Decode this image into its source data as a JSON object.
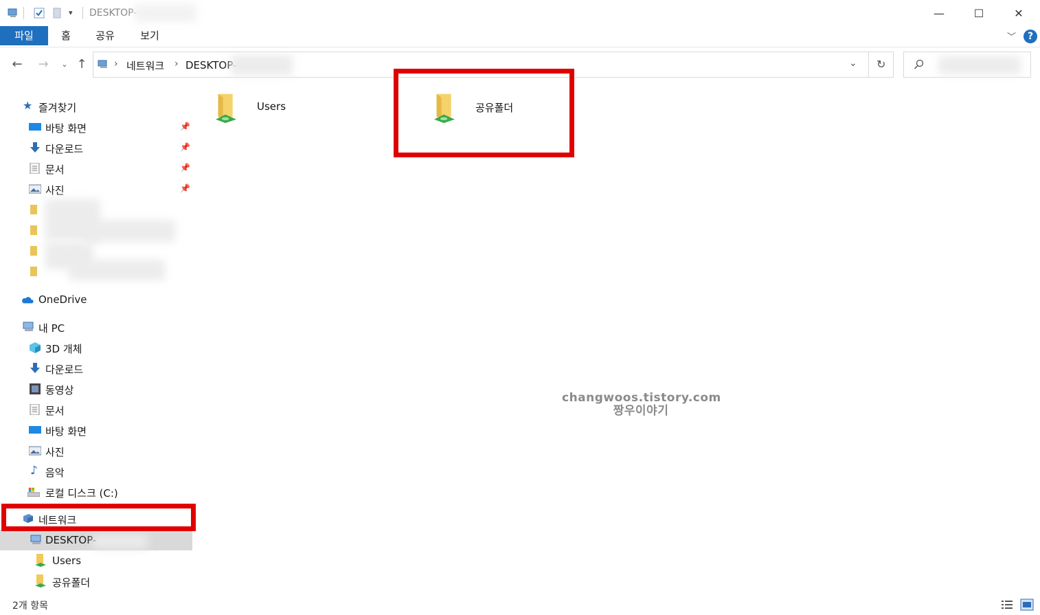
{
  "window": {
    "title": "DESKTOP-",
    "minimize": "—",
    "maximize": "☐",
    "close": "✕"
  },
  "ribbon": {
    "tabs": [
      "파일",
      "홈",
      "공유",
      "보기"
    ],
    "help": "?"
  },
  "address": {
    "crumbs": [
      "네트워크",
      "DESKTOP-"
    ]
  },
  "sidebar": {
    "quick_access": {
      "label": "즐겨찾기",
      "items": [
        {
          "label": "바탕 화면",
          "icon": "desktop-icon"
        },
        {
          "label": "다운로드",
          "icon": "download-icon"
        },
        {
          "label": "문서",
          "icon": "document-icon"
        },
        {
          "label": "사진",
          "icon": "pictures-icon"
        }
      ]
    },
    "onedrive": "OneDrive",
    "this_pc": {
      "label": "내 PC",
      "items": [
        {
          "label": "3D 개체",
          "icon": "3d-objects-icon"
        },
        {
          "label": "다운로드",
          "icon": "download-icon"
        },
        {
          "label": "동영상",
          "icon": "video-icon"
        },
        {
          "label": "문서",
          "icon": "document-icon"
        },
        {
          "label": "바탕 화면",
          "icon": "desktop-icon"
        },
        {
          "label": "사진",
          "icon": "pictures-icon"
        },
        {
          "label": "음악",
          "icon": "music-icon"
        },
        {
          "label": "로컬 디스크 (C:)",
          "icon": "drive-icon"
        }
      ]
    },
    "network": {
      "label": "네트워크",
      "computer": "DESKTOP-",
      "shares": [
        "Users",
        "공유폴더"
      ]
    }
  },
  "content": {
    "items": [
      {
        "label": "Users",
        "icon": "shared-folder-icon"
      },
      {
        "label": "공유폴더",
        "icon": "shared-folder-icon"
      }
    ]
  },
  "watermark": {
    "line1": "changwoos.tistory.com",
    "line2": "짱우이야기"
  },
  "status": {
    "count": "2개 항목"
  },
  "colors": {
    "accent": "#1f6fbf",
    "highlight": "#e00000",
    "selected_bg": "#d9d9d9"
  }
}
